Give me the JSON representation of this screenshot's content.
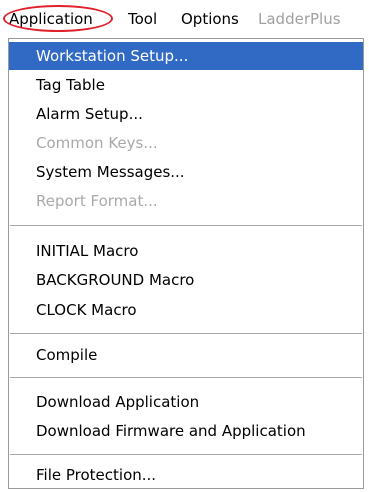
{
  "menubar": {
    "application": "Application",
    "tool": "Tool",
    "options": "Options",
    "ladderplus": "LadderPlus"
  },
  "menu": {
    "workstation_setup": "Workstation Setup...",
    "tag_table": "Tag Table",
    "alarm_setup": "Alarm Setup...",
    "common_keys": "Common Keys...",
    "system_messages": "System Messages...",
    "report_format": "Report Format...",
    "initial_macro": "INITIAL Macro",
    "background_macro": "BACKGROUND Macro",
    "clock_macro": "CLOCK Macro",
    "compile": "Compile",
    "download_application": "Download Application",
    "download_firmware_application": "Download Firmware and Application",
    "file_protection": "File Protection..."
  },
  "colors": {
    "selection": "#316ac5",
    "annotation_ring": "#e0202a",
    "disabled_text": "#a9a9a9"
  }
}
